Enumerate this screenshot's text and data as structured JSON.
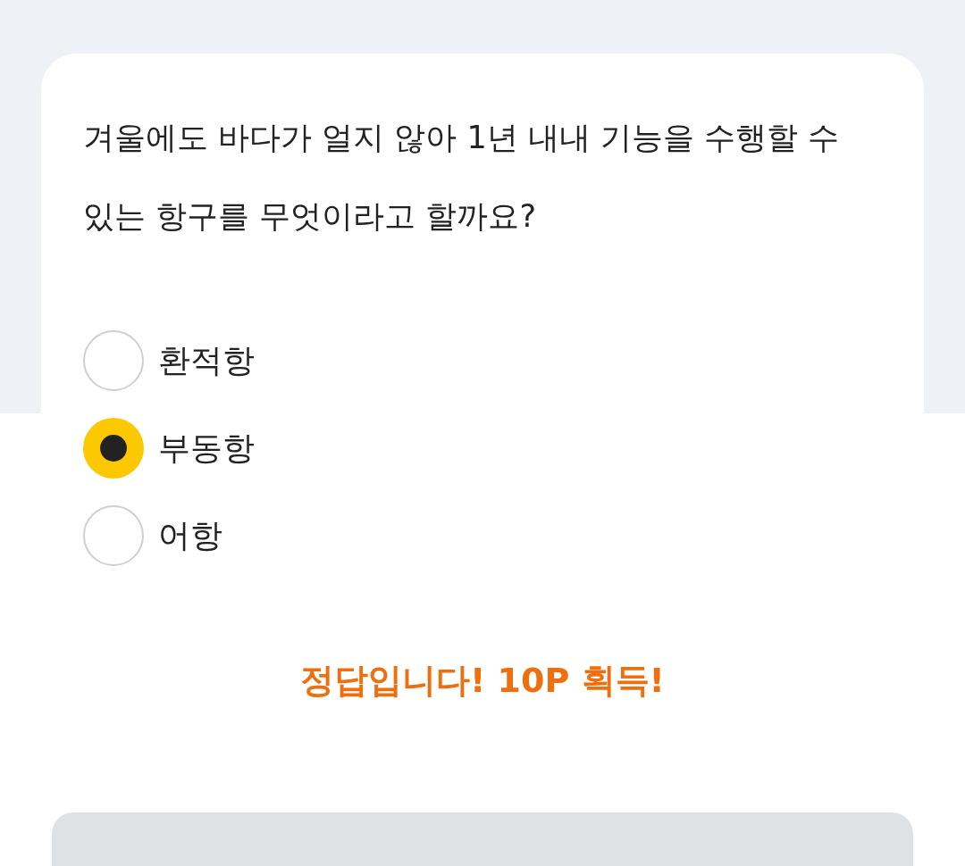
{
  "quiz": {
    "question": "겨울에도 바다가 얼지 않아 1년 내내 기능을 수행할 수 있는 항구를 무엇이라고 할까요?",
    "options": [
      {
        "label": "환적항",
        "selected": false
      },
      {
        "label": "부동항",
        "selected": true
      },
      {
        "label": "어항",
        "selected": false
      }
    ],
    "result": {
      "kind": "correct",
      "message": "정답입니다! 10P 획득!"
    }
  }
}
